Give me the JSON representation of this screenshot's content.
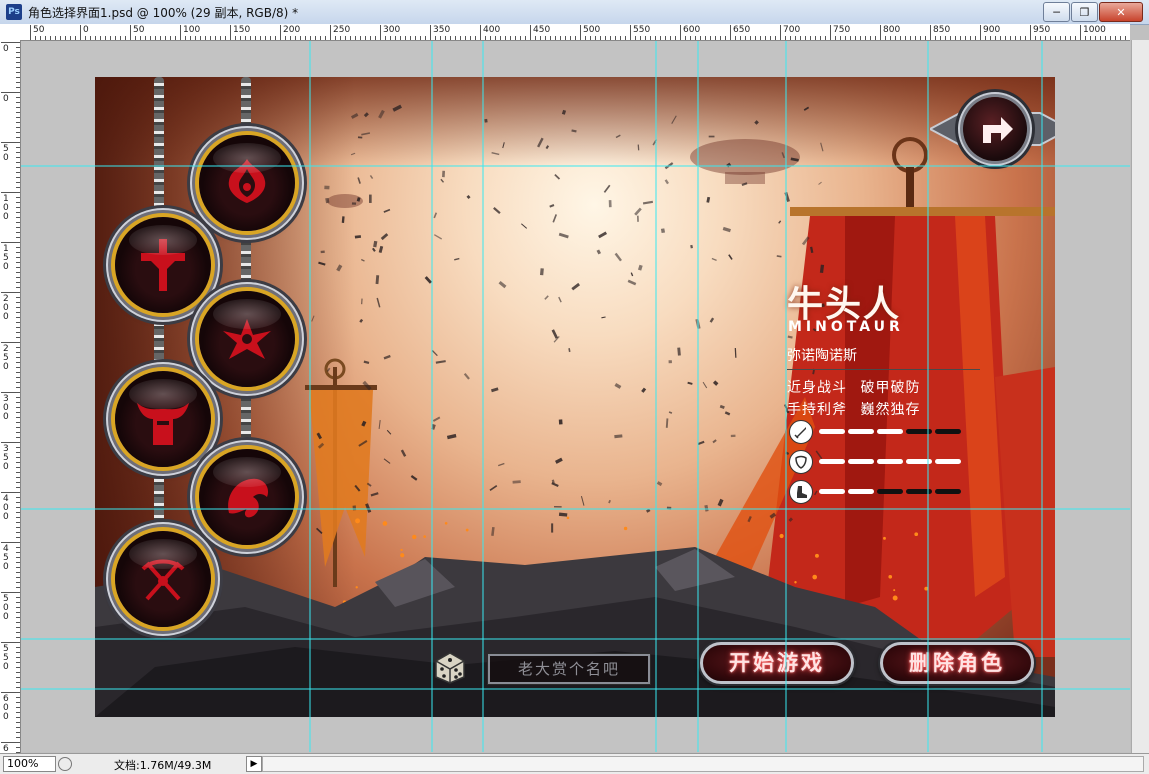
{
  "window": {
    "app_icon": "Ps",
    "title": "角色选择界面1.psd @ 100% (29 副本, RGB/8) *",
    "buttons": [
      "minimize-icon",
      "restore-icon",
      "close-icon"
    ]
  },
  "rulers": {
    "horizontal_labels": [
      "50",
      "0",
      "50",
      "100",
      "150",
      "200",
      "250",
      "300",
      "350",
      "400",
      "450",
      "500",
      "550",
      "600",
      "650",
      "700",
      "750",
      "800",
      "850",
      "900",
      "950",
      "1000"
    ],
    "vertical_labels": [
      "0",
      "0",
      "50",
      "100",
      "150",
      "200",
      "250",
      "300",
      "350",
      "400",
      "450",
      "500",
      "550",
      "600",
      "650"
    ]
  },
  "game": {
    "character": {
      "name": "牛头人",
      "english_name": "MINOTAUR",
      "alias": "弥诺陶诺斯",
      "traits": [
        "近身战斗  破甲破防",
        "手持利斧  巍然独存"
      ],
      "stats": [
        {
          "icon": "sword-icon",
          "filled": 3,
          "total": 5
        },
        {
          "icon": "shield-icon",
          "filled": 5,
          "total": 5
        },
        {
          "icon": "boot-icon",
          "filled": 2,
          "total": 5
        }
      ]
    },
    "class_emblems": [
      "emblem-flame-icon",
      "emblem-cross-icon",
      "emblem-winged-icon",
      "emblem-horned-icon",
      "emblem-dragon-icon",
      "emblem-bow-icon"
    ],
    "name_input_placeholder": "老大赏个名吧",
    "dice_icon": "dice-icon",
    "next_icon": "turn-right-arrow-icon",
    "start_button": "开始游戏",
    "delete_button": "删除角色",
    "accent_colors": {
      "gold": "#d9a524",
      "crimson": "#c8101c",
      "button_glow": "#ff4a4a"
    }
  },
  "statusbar": {
    "zoom": "100%",
    "doc_info": "文档:1.76M/49.3M"
  }
}
